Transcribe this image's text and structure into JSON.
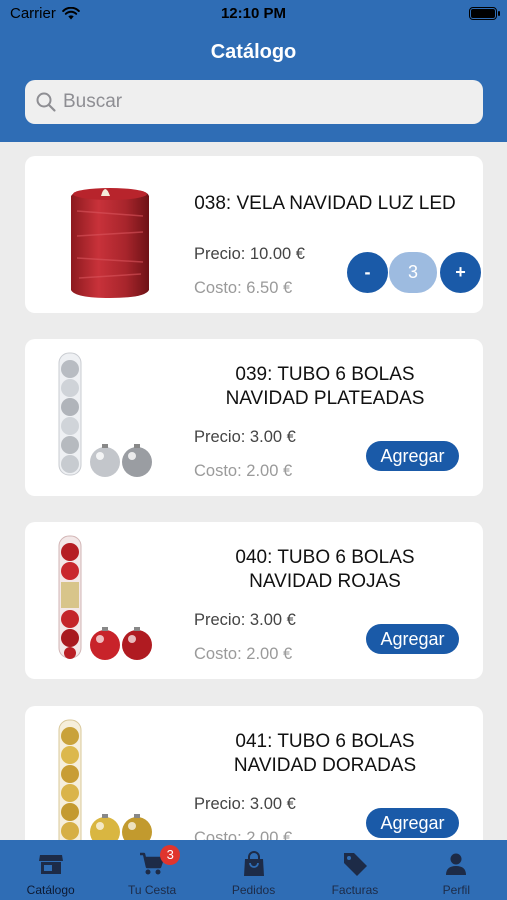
{
  "status_bar": {
    "carrier": "Carrier",
    "time": "12:10 PM"
  },
  "header": {
    "title": "Catálogo"
  },
  "search": {
    "placeholder": "Buscar",
    "value": ""
  },
  "products": [
    {
      "title": "038: VELA NAVIDAD LUZ LED",
      "price": "Precio: 10.00 €",
      "cost": "Costo: 6.50 €",
      "quantity": "3",
      "minus_label": "-",
      "plus_label": "+"
    },
    {
      "title_line1": "039: TUBO 6 BOLAS",
      "title_line2": "NAVIDAD PLATEADAS",
      "price": "Precio: 3.00 €",
      "cost": "Costo: 2.00 €",
      "add_label": "Agregar"
    },
    {
      "title_line1": "040: TUBO 6 BOLAS",
      "title_line2": "NAVIDAD ROJAS",
      "price": "Precio: 3.00 €",
      "cost": "Costo: 2.00 €",
      "add_label": "Agregar"
    },
    {
      "title_line1": "041: TUBO 6 BOLAS",
      "title_line2": "NAVIDAD DORADAS",
      "price": "Precio: 3.00 €",
      "cost": "Costo: 2.00 €",
      "add_label": "Agregar"
    }
  ],
  "tabbar": {
    "tabs": [
      {
        "label": "Catálogo",
        "icon": "store-icon"
      },
      {
        "label": "Tu Cesta",
        "icon": "cart-icon",
        "badge": "3"
      },
      {
        "label": "Pedidos",
        "icon": "bag-icon"
      },
      {
        "label": "Facturas",
        "icon": "tag-icon"
      },
      {
        "label": "Perfil",
        "icon": "person-icon"
      }
    ]
  },
  "colors": {
    "primary": "#2f6db5",
    "button": "#1a5aa8",
    "badge": "#e0352d",
    "background": "#ececec"
  }
}
